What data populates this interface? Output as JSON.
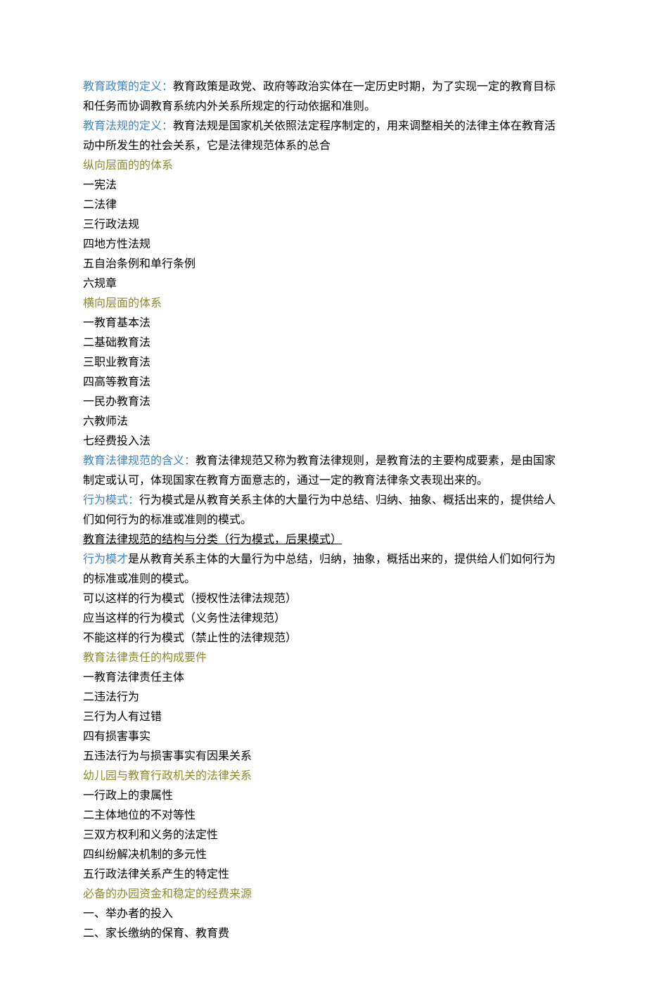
{
  "sections": {
    "policy_def": {
      "label": "教育政策的定义：",
      "text": "教育政策是政党、政府等政治实体在一定历史时期，为了实现一定的教育目标和任务而协调教育系统内外关系所规定的行动依据和准则。"
    },
    "regulation_def": {
      "label": "教育法规的定义：",
      "text": "教育法规是国家机关依照法定程序制定的，用来调整相关的法律主体在教育活动中所发生的社会关系，它是法律规范体系的总合"
    },
    "vertical_system": {
      "title": "纵向层面的的体系",
      "items": [
        "一宪法",
        "二法律",
        "三行政法规",
        "四地方性法规",
        "五自治条例和单行条例",
        "六规章"
      ]
    },
    "horizontal_system": {
      "title": "横向层面的体系",
      "items": [
        "一教育基本法",
        "二基础教育法",
        "三职业教育法",
        "四高等教育法",
        "一民办教育法",
        "六教师法",
        "七经费投入法"
      ]
    },
    "legal_norm_meaning": {
      "label": "教育法律规范的含义：",
      "text": "教育法律规范又称为教育法律规则，是教育法的主要构成要素，是由国家制定或认可，体现国家在教育方面意志的，通过一定的教育法律条文表现出来的。"
    },
    "behavior_mode": {
      "label": "行为模式：",
      "text": "行为模式是从教育关系主体的大量行为中总结、归纳、抽象、概括出来的，提供给人们如何行为的标准或准则的模式。"
    },
    "structure_underline": "教育法律规范的结构与分类（行为模式，后果模式）",
    "behavior_talent": {
      "label": "行为模才",
      "text": "是从教育关系主体的大量行为中总结，归纳，抽象，概括出来的，提供给人们如何行为的标准或准则的模式。"
    },
    "mode_types": [
      "可以这样的行为模式（授权性法律法规范）",
      "应当这样的行为模式（义务性法律规范）",
      "不能这样的行为模式（禁止性的法律规范）"
    ],
    "liability_elements": {
      "title": "教育法律责任的构成要件",
      "items": [
        "一教育法律责任主体",
        "二违法行为",
        "三行为人有过错",
        "四有损害事实",
        "五违法行为与损害事实有因果关系"
      ]
    },
    "kindergarten_relation": {
      "title": "幼儿园与教育行政机关的法律关系",
      "items": [
        "一行政上的隶属性",
        "二主体地位的不对等性",
        "三双方权利和义务的法定性",
        "四纠纷解决机制的多元性",
        "五行政法律关系产生的特定性"
      ]
    },
    "funding_sources": {
      "title": "必备的办园资金和稳定的经费来源",
      "items": [
        "一、举办者的投入",
        "二、家长缴纳的保育、教育费"
      ]
    }
  }
}
